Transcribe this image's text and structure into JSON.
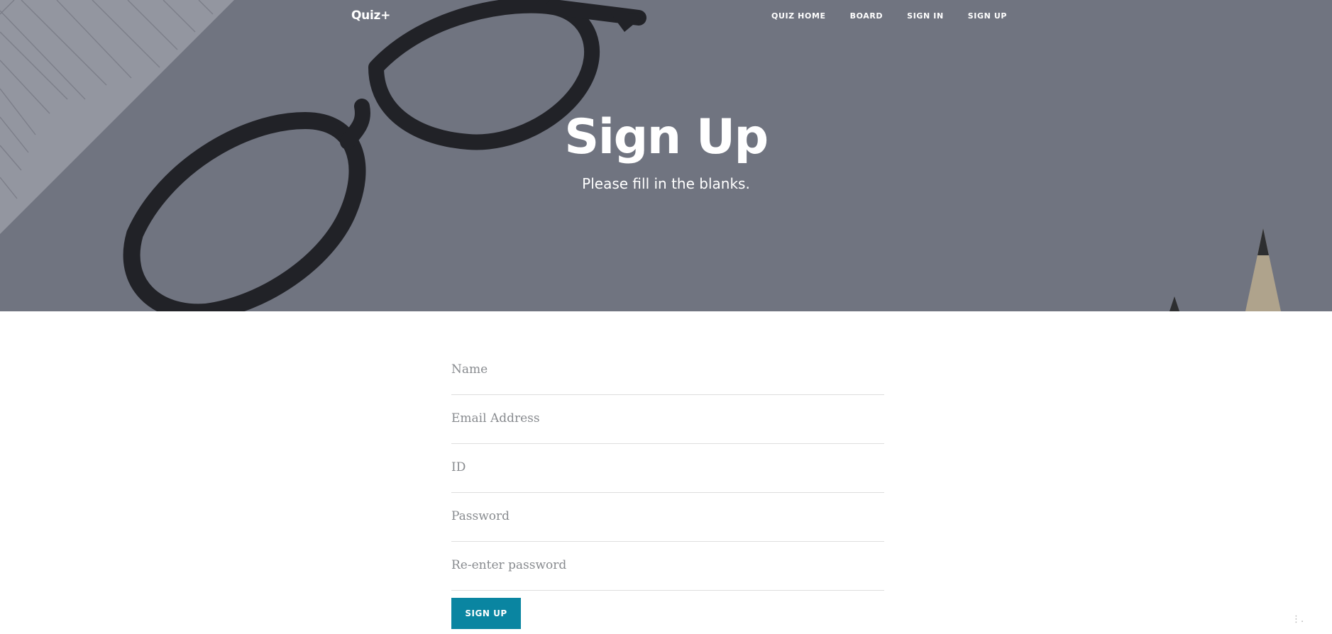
{
  "nav": {
    "brand": "Quiz+",
    "links": [
      {
        "label": "QUIZ HOME"
      },
      {
        "label": "BOARD"
      },
      {
        "label": "SIGN IN"
      },
      {
        "label": "SIGN UP"
      }
    ]
  },
  "hero": {
    "title": "Sign Up",
    "subtitle": "Please fill in the blanks."
  },
  "form": {
    "fields": [
      {
        "placeholder": "Name",
        "value": ""
      },
      {
        "placeholder": "Email Address",
        "value": ""
      },
      {
        "placeholder": "ID",
        "value": ""
      },
      {
        "placeholder": "Password",
        "value": ""
      },
      {
        "placeholder": "Re-enter password",
        "value": ""
      }
    ],
    "submit_label": "SIGN UP"
  },
  "colors": {
    "accent": "#0a85a1",
    "hero_tint": "#7a7d89"
  }
}
